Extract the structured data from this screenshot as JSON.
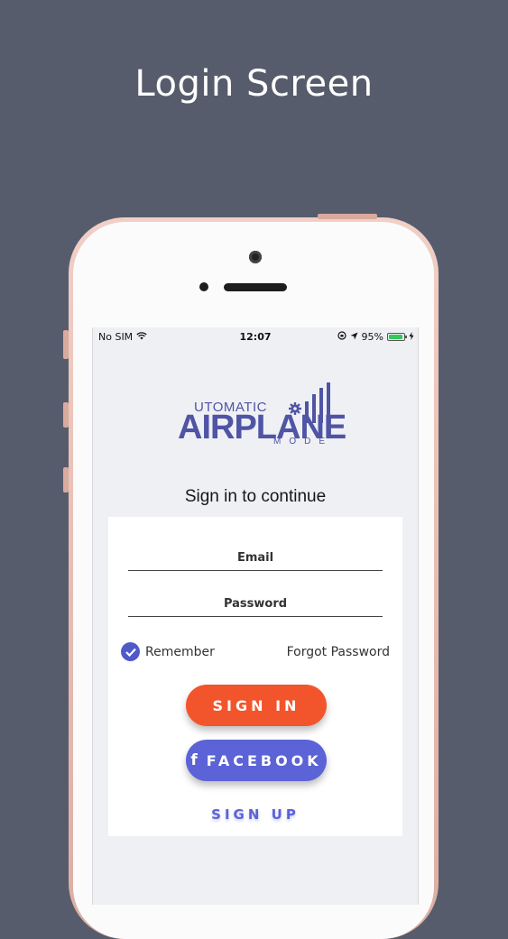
{
  "headline": "Login Screen",
  "status_bar": {
    "carrier": "No SIM",
    "time": "12:07",
    "battery": "95%",
    "battery_level": 0.95
  },
  "logo": {
    "line1": "UTOMATIC",
    "line2": "AIRPLANE",
    "line3": "MODE"
  },
  "subtitle": "Sign in to continue",
  "form": {
    "email_label": "Email",
    "password_label": "Password",
    "remember_label": "Remember",
    "remember_checked": true,
    "forgot_label": "Forgot Password"
  },
  "buttons": {
    "signin": "SIGN IN",
    "facebook": "FACEBOOK",
    "signup": "SIGN UP"
  },
  "colors": {
    "background": "#565c6c",
    "primary": "#f2552c",
    "facebook": "#5b63d6",
    "logo": "#4f54a5"
  },
  "icons": [
    "wifi-icon",
    "orientation-lock-icon",
    "location-arrow-icon",
    "battery-icon",
    "charging-icon",
    "checkmark-icon",
    "facebook-icon",
    "gear-icon",
    "signal-bars-icon"
  ]
}
